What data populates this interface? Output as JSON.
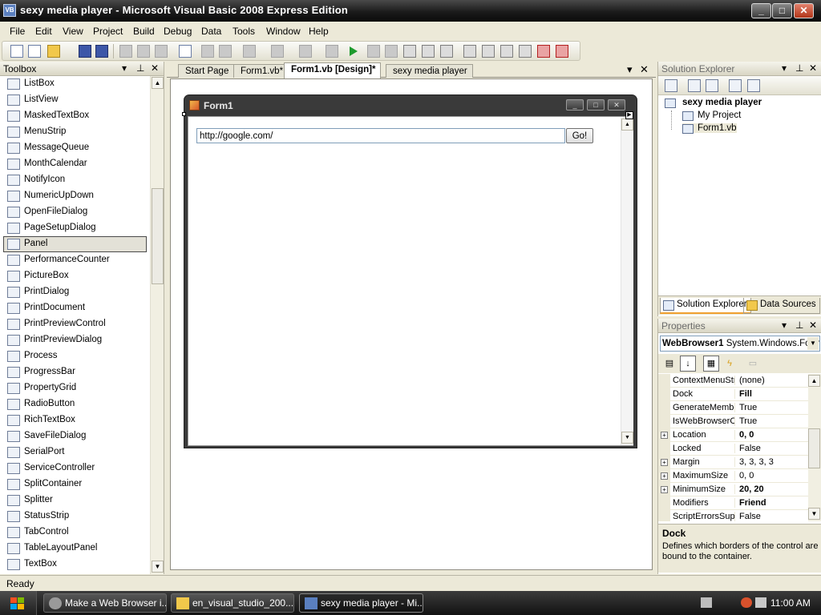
{
  "window": {
    "title": "sexy media player - Microsoft Visual Basic 2008 Express Edition",
    "app_icon_text": "VB",
    "minimize_glyph": "_",
    "maximize_glyph": "□",
    "close_glyph": "✕"
  },
  "menu": [
    "File",
    "Edit",
    "View",
    "Project",
    "Build",
    "Debug",
    "Data",
    "Tools",
    "Window",
    "Help"
  ],
  "toolbox": {
    "title": "Toolbox",
    "items": [
      "ListBox",
      "ListView",
      "MaskedTextBox",
      "MenuStrip",
      "MessageQueue",
      "MonthCalendar",
      "NotifyIcon",
      "NumericUpDown",
      "OpenFileDialog",
      "PageSetupDialog",
      "Panel",
      "PerformanceCounter",
      "PictureBox",
      "PrintDialog",
      "PrintDocument",
      "PrintPreviewControl",
      "PrintPreviewDialog",
      "Process",
      "ProgressBar",
      "PropertyGrid",
      "RadioButton",
      "RichTextBox",
      "SaveFileDialog",
      "SerialPort",
      "ServiceController",
      "SplitContainer",
      "Splitter",
      "StatusStrip",
      "TabControl",
      "TableLayoutPanel",
      "TextBox"
    ],
    "selected_item": "Panel"
  },
  "document_tabs": [
    {
      "label": "Start Page",
      "active": false
    },
    {
      "label": "Form1.vb*",
      "active": false
    },
    {
      "label": "Form1.vb [Design]*",
      "active": true
    },
    {
      "label": "sexy media player",
      "active": false
    }
  ],
  "form1": {
    "title": "Form1",
    "url_value": "http://google.com/",
    "go_label": "Go!"
  },
  "solution_explorer": {
    "title": "Solution Explorer",
    "project": "sexy media player",
    "nodes": [
      "My Project",
      "Form1.vb"
    ],
    "tabs": [
      "Solution Explorer",
      "Data Sources"
    ]
  },
  "properties": {
    "title": "Properties",
    "object_name": "WebBrowser1",
    "object_type": "System.Windows.Forms.WebBrowser",
    "rows": [
      {
        "name": "ContextMenuStrip",
        "value": "(none)",
        "expandable": false,
        "bold": false
      },
      {
        "name": "Dock",
        "value": "Fill",
        "expandable": false,
        "bold": true
      },
      {
        "name": "GenerateMember",
        "value": "True",
        "expandable": false,
        "bold": false
      },
      {
        "name": "IsWebBrowserContextMenuEnabled",
        "value": "True",
        "expandable": false,
        "bold": false
      },
      {
        "name": "Location",
        "value": "0, 0",
        "expandable": true,
        "bold": true
      },
      {
        "name": "Locked",
        "value": "False",
        "expandable": false,
        "bold": false
      },
      {
        "name": "Margin",
        "value": "3, 3, 3, 3",
        "expandable": true,
        "bold": false
      },
      {
        "name": "MaximumSize",
        "value": "0, 0",
        "expandable": true,
        "bold": false
      },
      {
        "name": "MinimumSize",
        "value": "20, 20",
        "expandable": true,
        "bold": true
      },
      {
        "name": "Modifiers",
        "value": "Friend",
        "expandable": false,
        "bold": true
      },
      {
        "name": "ScriptErrorsSuppressed",
        "value": "False",
        "expandable": false,
        "bold": false
      }
    ],
    "description_title": "Dock",
    "description_text": "Defines which borders of the control are bound to the container."
  },
  "status": {
    "text": "Ready"
  },
  "taskbar": {
    "items": [
      {
        "label": "Make a Web Browser i...",
        "active": false
      },
      {
        "label": "en_visual_studio_200...",
        "active": false
      },
      {
        "label": "sexy media player - Mi...",
        "active": true
      }
    ],
    "clock": "11:00 AM"
  },
  "colors": {
    "accent": "#f0a030",
    "vista_orange": "#f2b84a",
    "titlebar": "#1b1b1b"
  }
}
